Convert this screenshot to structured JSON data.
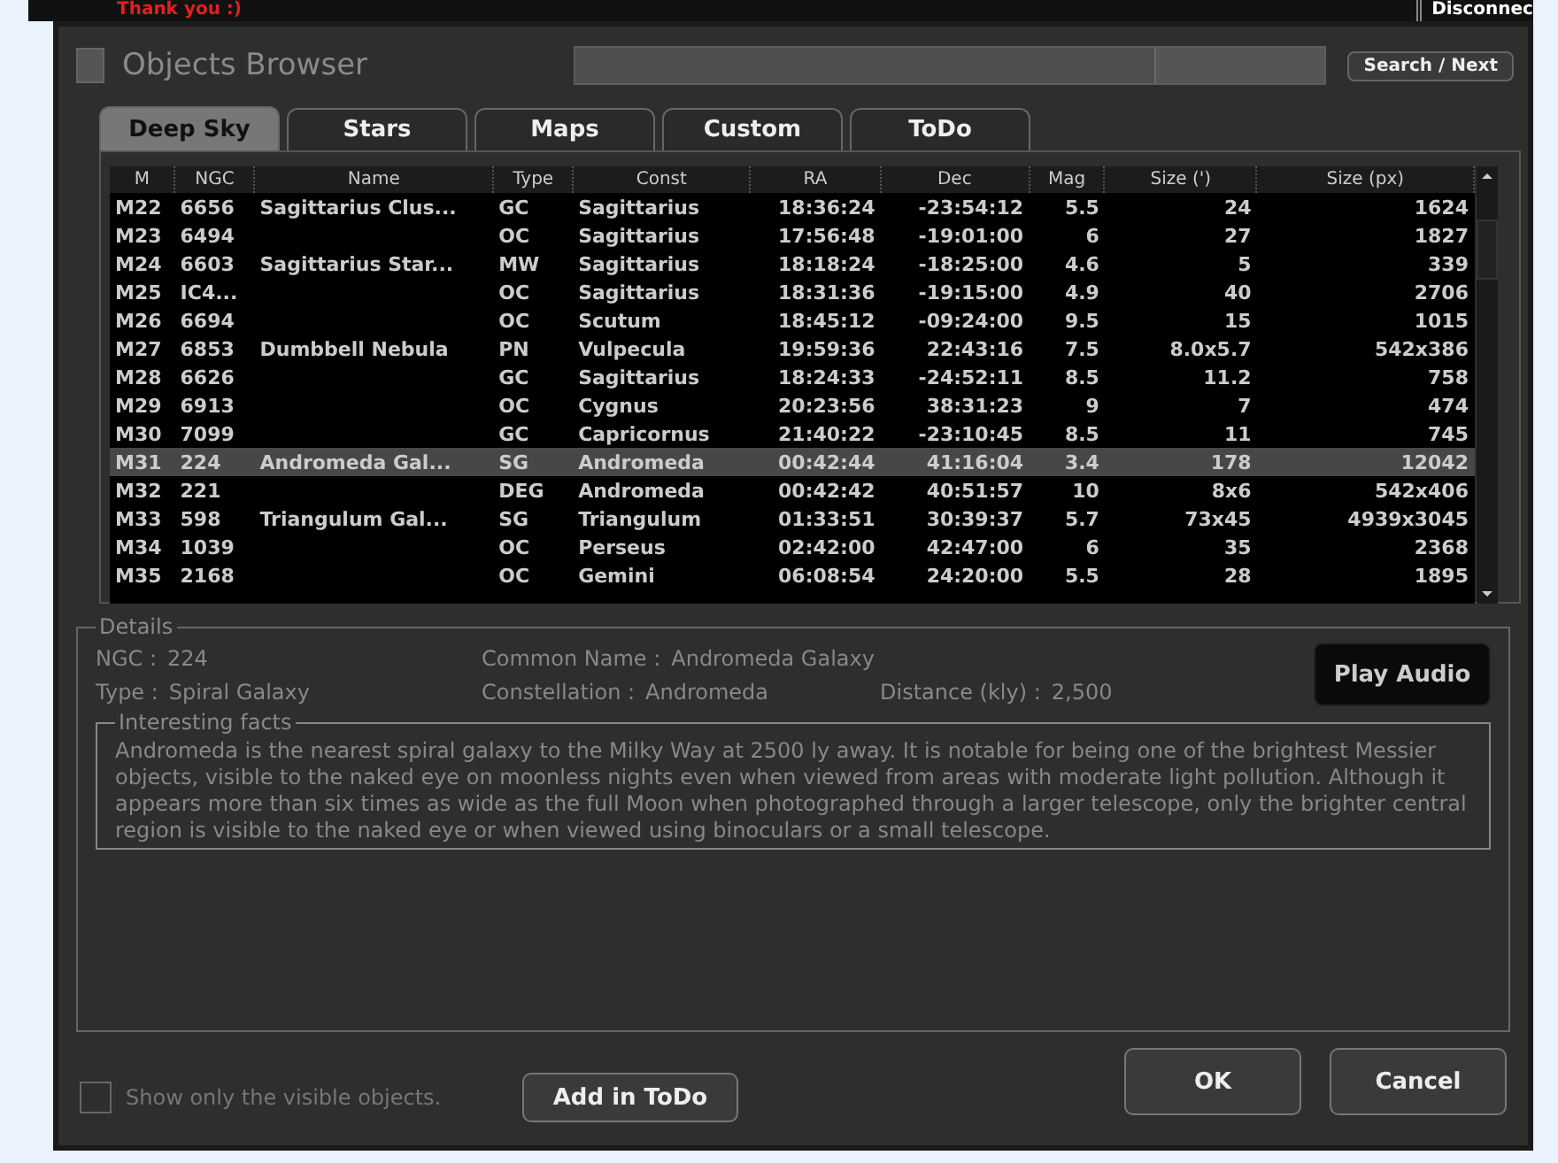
{
  "background": {
    "top_note": "Thank you :)",
    "status": "Disconnec"
  },
  "window": {
    "title": "Objects Browser",
    "search_button": "Search / Next"
  },
  "tabs": [
    {
      "label": "Deep Sky",
      "selected": true
    },
    {
      "label": "Stars",
      "selected": false
    },
    {
      "label": "Maps",
      "selected": false
    },
    {
      "label": "Custom",
      "selected": false
    },
    {
      "label": "ToDo",
      "selected": false
    }
  ],
  "table": {
    "columns": [
      "M",
      "NGC",
      "Name",
      "Type",
      "Const",
      "RA",
      "Dec",
      "Mag",
      "Size (')",
      "Size (px)"
    ],
    "rows": [
      {
        "selected": false,
        "cells": [
          "M22",
          "6656",
          "Sagittarius Clus...",
          "GC",
          "Sagittarius",
          "18:36:24",
          "-23:54:12",
          "5.5",
          "24",
          "1624"
        ]
      },
      {
        "selected": false,
        "cells": [
          "M23",
          "6494",
          "",
          "OC",
          "Sagittarius",
          "17:56:48",
          "-19:01:00",
          "6",
          "27",
          "1827"
        ]
      },
      {
        "selected": false,
        "cells": [
          "M24",
          "6603",
          "Sagittarius Star...",
          "MW",
          "Sagittarius",
          "18:18:24",
          "-18:25:00",
          "4.6",
          "5",
          "339"
        ]
      },
      {
        "selected": false,
        "cells": [
          "M25",
          "IC4...",
          "",
          "OC",
          "Sagittarius",
          "18:31:36",
          "-19:15:00",
          "4.9",
          "40",
          "2706"
        ]
      },
      {
        "selected": false,
        "cells": [
          "M26",
          "6694",
          "",
          "OC",
          "Scutum",
          "18:45:12",
          "-09:24:00",
          "9.5",
          "15",
          "1015"
        ]
      },
      {
        "selected": false,
        "cells": [
          "M27",
          "6853",
          "Dumbbell Nebula",
          "PN",
          "Vulpecula",
          "19:59:36",
          "22:43:16",
          "7.5",
          "8.0x5.7",
          "542x386"
        ]
      },
      {
        "selected": false,
        "cells": [
          "M28",
          "6626",
          "",
          "GC",
          "Sagittarius",
          "18:24:33",
          "-24:52:11",
          "8.5",
          "11.2",
          "758"
        ]
      },
      {
        "selected": false,
        "cells": [
          "M29",
          "6913",
          "",
          "OC",
          "Cygnus",
          "20:23:56",
          "38:31:23",
          "9",
          "7",
          "474"
        ]
      },
      {
        "selected": false,
        "cells": [
          "M30",
          "7099",
          "",
          "GC",
          "Capricornus",
          "21:40:22",
          "-23:10:45",
          "8.5",
          "11",
          "745"
        ]
      },
      {
        "selected": true,
        "cells": [
          "M31",
          "224",
          "Andromeda Gal...",
          "SG",
          "Andromeda",
          "00:42:44",
          "41:16:04",
          "3.4",
          "178",
          "12042"
        ]
      },
      {
        "selected": false,
        "cells": [
          "M32",
          "221",
          "",
          "DEG",
          "Andromeda",
          "00:42:42",
          "40:51:57",
          "10",
          "8x6",
          "542x406"
        ]
      },
      {
        "selected": false,
        "cells": [
          "M33",
          "598",
          "Triangulum Gal...",
          "SG",
          "Triangulum",
          "01:33:51",
          "30:39:37",
          "5.7",
          "73x45",
          "4939x3045"
        ]
      },
      {
        "selected": false,
        "cells": [
          "M34",
          "1039",
          "",
          "OC",
          "Perseus",
          "02:42:00",
          "42:47:00",
          "6",
          "35",
          "2368"
        ]
      },
      {
        "selected": false,
        "cells": [
          "M35",
          "2168",
          "",
          "OC",
          "Gemini",
          "06:08:54",
          "24:20:00",
          "5.5",
          "28",
          "1895"
        ]
      }
    ]
  },
  "details": {
    "legend": "Details",
    "fields": [
      {
        "label": "NGC :",
        "value": "224"
      },
      {
        "label": "Common Name :",
        "value": "Andromeda Galaxy"
      },
      {
        "label": "Type :",
        "value": "Spiral Galaxy"
      },
      {
        "label": "Constellation :",
        "value": "Andromeda"
      },
      {
        "label": "Distance (kly) :",
        "value": "2,500"
      }
    ],
    "play_button": "Play Audio",
    "facts_legend": "Interesting facts",
    "facts": "Andromeda is the nearest spiral galaxy to the Milky Way at 2500 ly away. It is notable for being one of the brightest Messier objects, visible to the naked eye on moonless nights even when viewed from areas with moderate light pollution. Although it appears more than six times as wide as the full Moon when photographed through a larger telescope, only the brighter central region is visible to the naked eye or when viewed using binoculars or a small telescope."
  },
  "footer": {
    "checkbox": {
      "label": "Show only the visible objects.",
      "checked": false
    },
    "add_button": "Add in ToDo",
    "ok_button": "OK",
    "cancel_button": "Cancel"
  }
}
